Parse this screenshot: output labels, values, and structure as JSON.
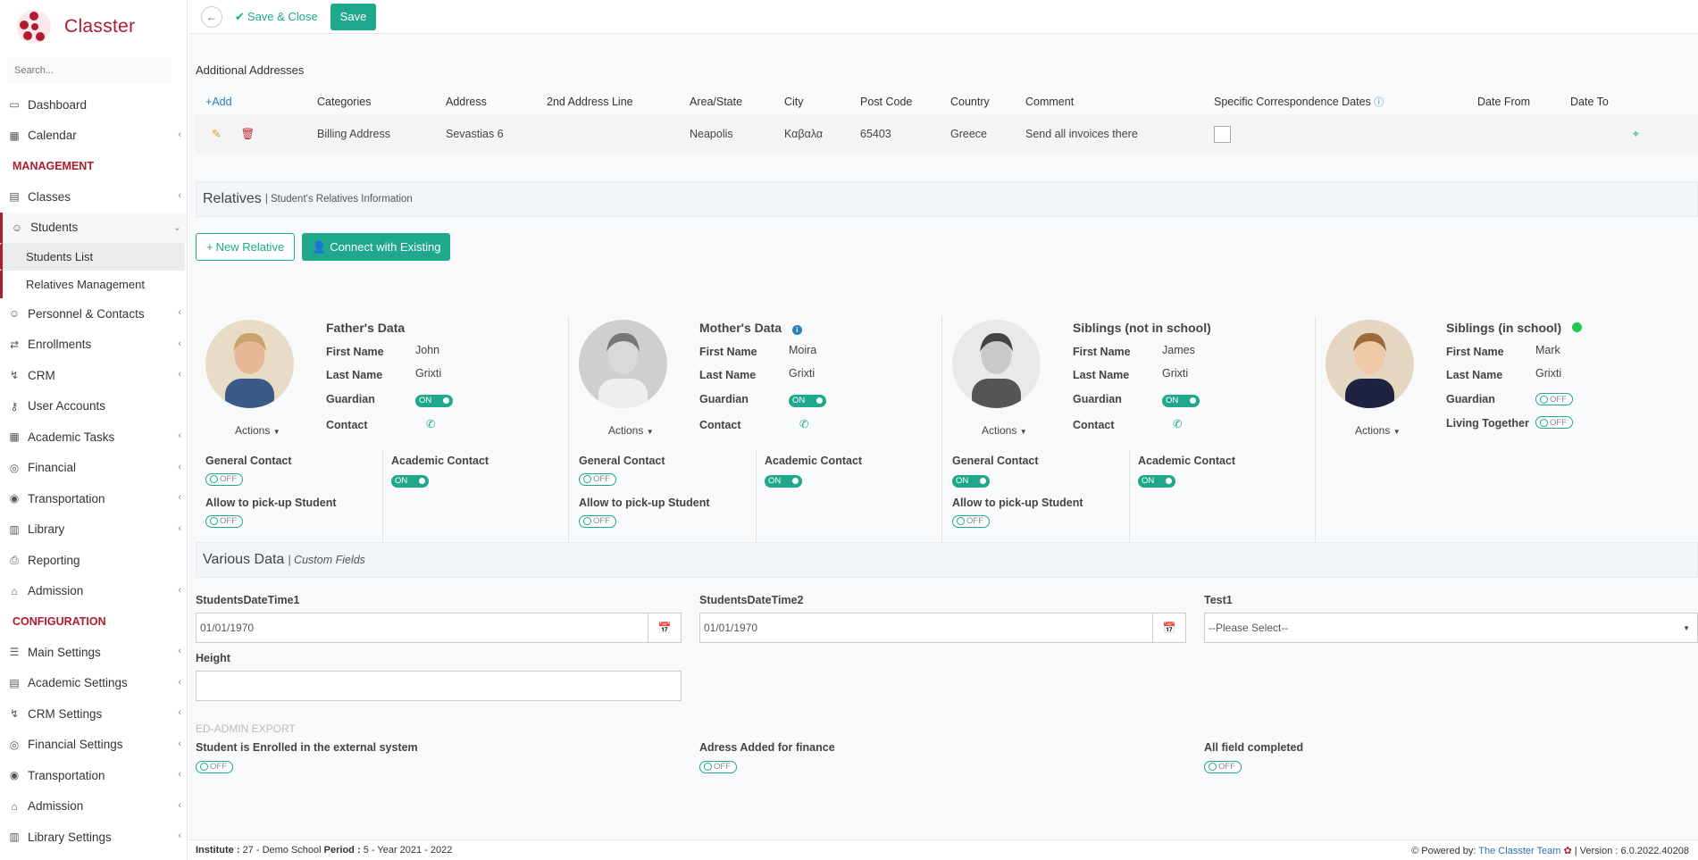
{
  "app": {
    "name": "Classter",
    "search_placeholder": "Search..."
  },
  "sidebar": {
    "items_top": [
      {
        "label": "Dashboard",
        "icon": "monitor-icon",
        "chevron": false
      },
      {
        "label": "Calendar",
        "icon": "calendar-icon",
        "chevron": true
      }
    ],
    "section_management": "MANAGEMENT",
    "items_mgmt": [
      {
        "label": "Classes",
        "icon": "classes-icon",
        "chevron": true
      },
      {
        "label": "Students",
        "icon": "students-icon",
        "chevron": true
      }
    ],
    "students_sub": [
      "Students List",
      "Relatives Management"
    ],
    "items_mgmt2": [
      {
        "label": "Personnel & Contacts",
        "icon": "personnel-icon",
        "chevron": true
      },
      {
        "label": "Enrollments",
        "icon": "enrollments-icon",
        "chevron": true
      },
      {
        "label": "CRM",
        "icon": "crm-icon",
        "chevron": true
      },
      {
        "label": "User Accounts",
        "icon": "key-icon",
        "chevron": false
      },
      {
        "label": "Academic Tasks",
        "icon": "tasks-icon",
        "chevron": true
      },
      {
        "label": "Financial",
        "icon": "coins-icon",
        "chevron": true
      },
      {
        "label": "Transportation",
        "icon": "bus-icon",
        "chevron": true
      },
      {
        "label": "Library",
        "icon": "library-icon",
        "chevron": true
      },
      {
        "label": "Reporting",
        "icon": "printer-icon",
        "chevron": false
      },
      {
        "label": "Admission",
        "icon": "bank-icon",
        "chevron": true
      }
    ],
    "section_config": "CONFIGURATION",
    "items_config": [
      {
        "label": "Main Settings",
        "icon": "sliders-icon",
        "chevron": true
      },
      {
        "label": "Academic Settings",
        "icon": "academic-settings-icon",
        "chevron": true
      },
      {
        "label": "CRM Settings",
        "icon": "crm-icon",
        "chevron": true
      },
      {
        "label": "Financial Settings",
        "icon": "coins-icon",
        "chevron": true
      },
      {
        "label": "Transportation",
        "icon": "bus-icon",
        "chevron": true
      },
      {
        "label": "Admission",
        "icon": "bank-icon",
        "chevron": true
      },
      {
        "label": "Library Settings",
        "icon": "library-icon",
        "chevron": true
      }
    ]
  },
  "toolbar": {
    "save_close": "Save & Close",
    "save": "Save"
  },
  "addresses": {
    "title": "Additional Addresses",
    "add": "Add",
    "headers": [
      "Categories",
      "Address",
      "2nd Address Line",
      "Area/State",
      "City",
      "Post Code",
      "Country",
      "Comment",
      "Specific Correspondence Dates",
      "Date From",
      "Date To"
    ],
    "row": {
      "category": "Billing Address",
      "address": "Sevastias 6",
      "line2": "",
      "area": "Neapolis",
      "city": "Καβαλα",
      "post_code": "65403",
      "country": "Greece",
      "comment": "Send all invoices there",
      "specific_dates": false
    }
  },
  "relatives": {
    "title": "Relatives",
    "subtitle": "Student's Relatives Information",
    "new_relative": "New Relative",
    "connect_existing": "Connect with Existing",
    "actions_label": "Actions",
    "field_labels": {
      "first_name": "First Name",
      "last_name": "Last Name",
      "guardian": "Guardian",
      "contact": "Contact",
      "living_together": "Living Together",
      "general_contact": "General Contact",
      "academic_contact": "Academic Contact",
      "pickup": "Allow to pick-up Student"
    },
    "cards": [
      {
        "title": "Father's Data",
        "first_name": "John",
        "last_name": "Grixti",
        "guardian": "ON",
        "general_contact": "OFF",
        "academic_contact": "ON",
        "pickup": "OFF"
      },
      {
        "title": "Mother's Data",
        "first_name": "Moira",
        "last_name": "Grixti",
        "guardian": "ON",
        "general_contact": "OFF",
        "academic_contact": "ON",
        "pickup": "OFF"
      },
      {
        "title": "Siblings (not in school)",
        "first_name": "James",
        "last_name": "Grixti",
        "guardian": "ON",
        "general_contact": "ON",
        "academic_contact": "ON",
        "pickup": "OFF"
      },
      {
        "title": "Siblings (in school)",
        "first_name": "Mark",
        "last_name": "Grixti",
        "guardian": "OFF",
        "living_together": "OFF"
      }
    ]
  },
  "various": {
    "title": "Various Data",
    "subtitle": "Custom Fields",
    "fields": {
      "dt1_label": "StudentsDateTime1",
      "dt1_value": "01/01/1970",
      "dt2_label": "StudentsDateTime2",
      "dt2_value": "01/01/1970",
      "test1_label": "Test1",
      "test1_value": "--Please Select--",
      "height_label": "Height",
      "height_value": ""
    },
    "export_title": "ED-ADMIN EXPORT",
    "export_fields": [
      {
        "label": "Student is Enrolled in the external system",
        "value": "OFF"
      },
      {
        "label": "Adress Added for finance",
        "value": "OFF"
      },
      {
        "label": "All field completed",
        "value": "OFF"
      }
    ]
  },
  "footer": {
    "institute_label": "Institute :",
    "institute_value": "27 - Demo School",
    "period_label": "Period :",
    "period_value": "5 - Year 2021 - 2022",
    "powered": "Powered by:",
    "team": "The Classter Team",
    "version": "| Version : 6.0.2022.40208"
  },
  "colors": {
    "brand": "#b01c2e",
    "accent": "#1fa88c"
  }
}
